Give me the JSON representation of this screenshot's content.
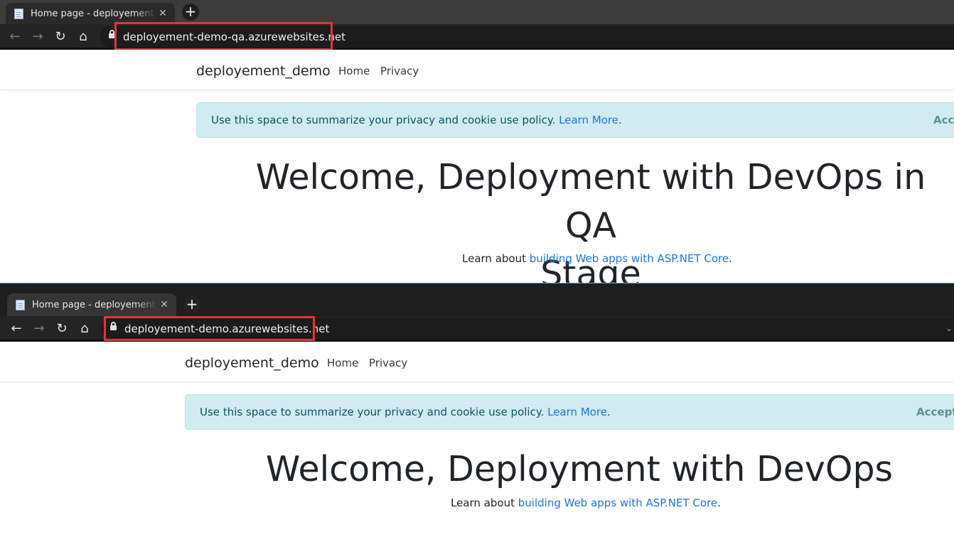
{
  "screens": [
    {
      "tab_title": "Home page - deployement_demo",
      "url": "deployement-demo-qa.azurewebsites.net",
      "brand": "deployement_demo",
      "nav": {
        "home": "Home",
        "privacy": "Privacy"
      },
      "cookie": {
        "text": "Use this space to summarize your privacy and cookie use policy.",
        "link": "Learn More",
        "accept": "Accept"
      },
      "heading_line1": "Welcome, Deployment with DevOps in QA",
      "heading_line2": "Stage",
      "sub": {
        "prefix": "Learn about",
        "link": "building Web apps with ASP.NET Core"
      }
    },
    {
      "tab_title": "Home page - deployement_demo",
      "url": "deployement-demo.azurewebsites.net",
      "brand": "deployement_demo",
      "nav": {
        "home": "Home",
        "privacy": "Privacy"
      },
      "cookie": {
        "text": "Use this space to summarize your privacy and cookie use policy.",
        "link": "Learn More",
        "accept": "Accept"
      },
      "heading_line1": "Welcome, Deployment with DevOps",
      "sub": {
        "prefix": "Learn about",
        "link": "building Web apps with ASP.NET Core"
      }
    }
  ],
  "icons": {
    "back": "arrow-left-icon",
    "forward": "arrow-right-icon",
    "reload": "reload-icon",
    "home": "home-icon",
    "lock": "lock-icon",
    "close": "close-icon",
    "new_tab": "plus-icon"
  },
  "colors": {
    "url_highlight": "#e0353b",
    "link": "#1a73e8",
    "alert_bg": "#d1ecf1",
    "alert_text": "#0c5460"
  }
}
